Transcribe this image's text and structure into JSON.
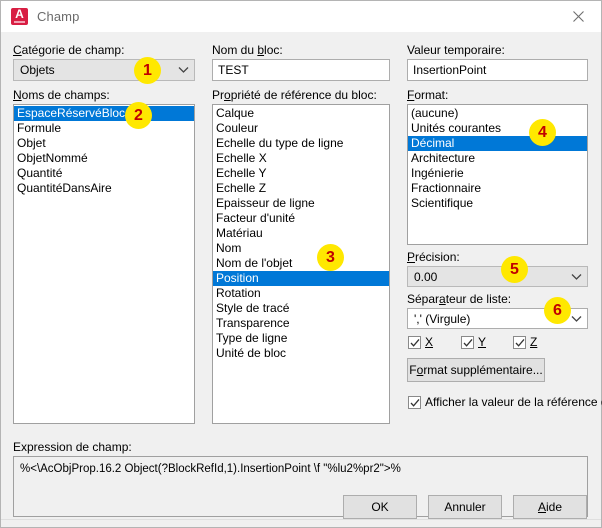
{
  "window": {
    "title": "Champ",
    "app_icon": "autocad-a-icon",
    "close_icon": "close-icon"
  },
  "left_panel": {
    "category_label_pre": "C",
    "category_label_key": "a",
    "category_label_post": "tégorie de champ:",
    "category_label_full": "Catégorie de champ:",
    "category_value": "Objets",
    "field_names_label_pre": "",
    "field_names_label_key": "N",
    "field_names_label_post": "oms de champs:",
    "field_names_label_full": "Noms de champs:",
    "field_names": [
      "EspaceRéservéBloc",
      "Formule",
      "Objet",
      "ObjetNommé",
      "Quantité",
      "QuantitéDansAire"
    ],
    "field_names_selected_index": 0
  },
  "middle_panel": {
    "block_name_label_full": "Nom du bloc:",
    "block_name_label_pre": "Nom du ",
    "block_name_label_key": "b",
    "block_name_label_post": "loc:",
    "block_name_value": "TEST",
    "block_prop_label_full": "Propriété de référence du bloc:",
    "block_prop_label_pre": "Pr",
    "block_prop_label_key": "o",
    "block_prop_label_post": "priété de référence du bloc:",
    "block_properties": [
      "Calque",
      "Couleur",
      "Echelle du type de ligne",
      "Echelle X",
      "Echelle Y",
      "Echelle Z",
      "Epaisseur de ligne",
      "Facteur d'unité",
      "Matériau",
      "Nom",
      "Nom de l'objet",
      "Position",
      "Rotation",
      "Style de tracé",
      "Transparence",
      "Type de ligne",
      "Unité de bloc"
    ],
    "block_properties_selected_index": 11
  },
  "right_panel": {
    "temp_value_label_full": "Valeur temporaire:",
    "temp_value": "InsertionPoint",
    "format_label_full": "Format:",
    "format_label_pre": "",
    "format_label_key": "F",
    "format_label_post": "ormat:",
    "format_options": [
      "(aucune)",
      "Unités courantes",
      "Décimal",
      "Architecture",
      "Ingénierie",
      "Fractionnaire",
      "Scientifique"
    ],
    "format_selected_index": 2,
    "precision_label_full": "Précision:",
    "precision_label_pre": "",
    "precision_label_key": "P",
    "precision_label_post": "récision:",
    "precision_value": "0.00",
    "separator_label_full": "Séparateur de liste:",
    "separator_label_pre": "Sépar",
    "separator_label_key": "a",
    "separator_label_post": "teur de liste:",
    "separator_value": "',' (Virgule)",
    "checkbox_x": "X",
    "checkbox_y": "Y",
    "checkbox_z": "Z",
    "checkbox_x_checked": true,
    "checkbox_y_checked": true,
    "checkbox_z_checked": true,
    "extra_format_button_full": "Format supplémentaire...",
    "extra_format_button_pre": "F",
    "extra_format_button_key": "o",
    "extra_format_button_post": "rmat supplémentaire...",
    "show_ref_value_label": "Afficher la valeur de la référence du bloc",
    "show_ref_value_checked": true
  },
  "expression": {
    "label_full": "Expression de champ:",
    "value": "%<\\AcObjProp.16.2 Object(?BlockRefId,1).InsertionPoint \\f \"%lu2%pr2\">%"
  },
  "footer": {
    "ok_label": "OK",
    "cancel_label": "Annuler",
    "help_label_full": "Aide",
    "help_label_key": "A",
    "help_label_post": "ide"
  },
  "annotations": {
    "b1": "1",
    "b2": "2",
    "b3": "3",
    "b4": "4",
    "b5": "5",
    "b6": "6"
  },
  "colors": {
    "selection_blue": "#0078d7",
    "badge_yellow": "#ffe800",
    "badge_text": "#c00000",
    "dialog_bg": "#f0f0f0",
    "brand_red": "#d81e43"
  }
}
